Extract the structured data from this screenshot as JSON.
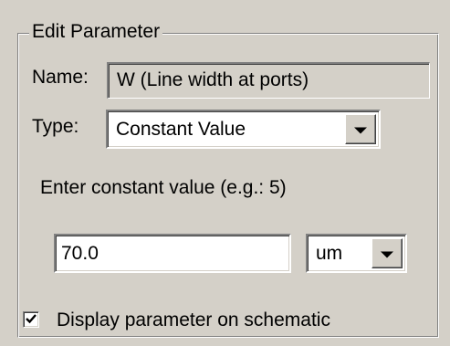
{
  "group": {
    "title": "Edit Parameter"
  },
  "name_field": {
    "label": "Name:",
    "value": "W (Line width at ports)"
  },
  "type_field": {
    "label": "Type:",
    "selected": "Constant Value"
  },
  "constant": {
    "prompt": "Enter constant value (e.g.: 5)",
    "value": "70.0"
  },
  "units": {
    "selected": "um"
  },
  "display_option": {
    "label": "Display parameter on schematic",
    "checked": true
  },
  "icons": {
    "dropdown": "chevron-down-icon",
    "check": "checkmark-icon"
  },
  "colors": {
    "face": "#d4d0c8",
    "field": "#ffffff",
    "shadow": "#808080",
    "highlight": "#ffffff"
  }
}
